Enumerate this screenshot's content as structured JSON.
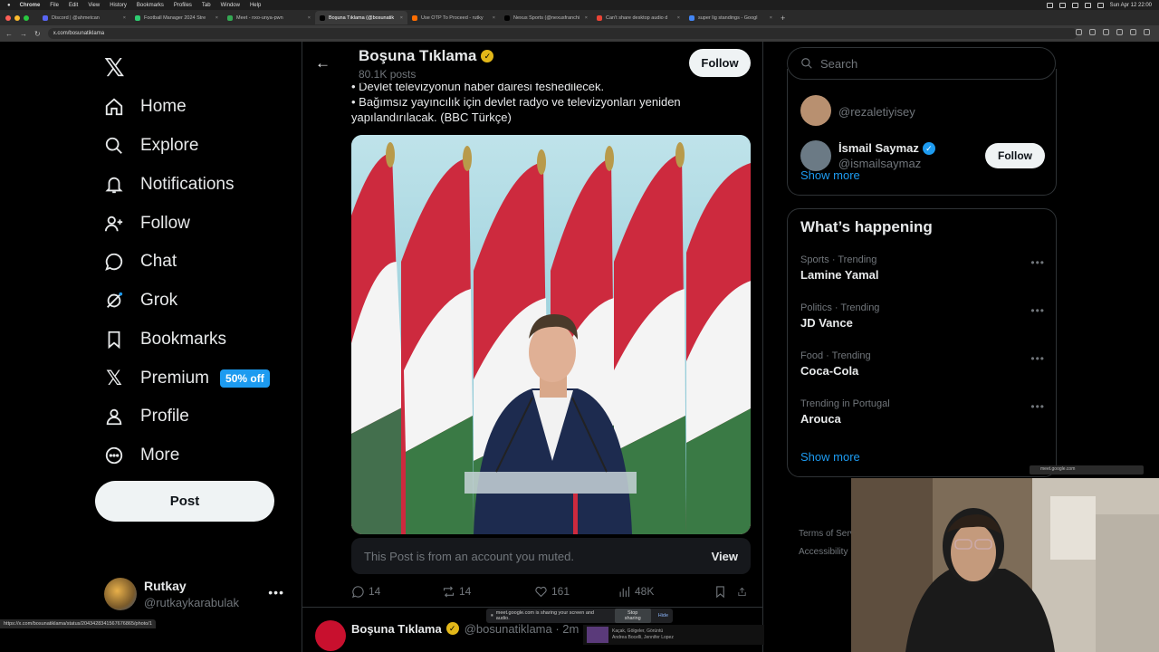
{
  "menubar": {
    "app": "Chrome",
    "items": [
      "File",
      "Edit",
      "View",
      "History",
      "Bookmarks",
      "Profiles",
      "Tab",
      "Window",
      "Help"
    ],
    "datetime": "Sun Apr 12  22:00"
  },
  "browser": {
    "tabs": [
      {
        "label": "Discord | @ahmetcan",
        "color": "#5865f2"
      },
      {
        "label": "Football Manager 2024 Stre",
        "color": "#2ecc71"
      },
      {
        "label": "Meet - nxo-unya-pwn",
        "color": "#34a853"
      },
      {
        "label": "Boşuna Tıklama (@bosunatik",
        "color": "#000000",
        "active": true
      },
      {
        "label": "Use OTP To Proceed - rutky",
        "color": "#ff6d00"
      },
      {
        "label": "Nexus Sports (@nexusfranchi",
        "color": "#000000"
      },
      {
        "label": "Can't share desktop audio d",
        "color": "#ea4335"
      },
      {
        "label": "super lig standings - Googl",
        "color": "#4285f4"
      }
    ],
    "url": "x.com/bosunatiklama"
  },
  "nav": {
    "items": [
      {
        "label": "Home",
        "icon": "home-icon"
      },
      {
        "label": "Explore",
        "icon": "search-icon"
      },
      {
        "label": "Notifications",
        "icon": "bell-icon"
      },
      {
        "label": "Follow",
        "icon": "person-add-icon"
      },
      {
        "label": "Chat",
        "icon": "chat-icon"
      },
      {
        "label": "Grok",
        "icon": "grok-icon"
      },
      {
        "label": "Bookmarks",
        "icon": "bookmark-icon"
      },
      {
        "label": "Premium",
        "icon": "x-icon"
      },
      {
        "label": "Profile",
        "icon": "person-icon"
      },
      {
        "label": "More",
        "icon": "more-circle-icon"
      }
    ],
    "premium_badge": "50% off",
    "post_label": "Post"
  },
  "account": {
    "name": "Rutkay",
    "handle": "@rutkaykarabulak"
  },
  "header": {
    "name": "Boşuna Tıklama",
    "posts": "80.1K posts",
    "follow_label": "Follow"
  },
  "tweet": {
    "lines": [
      "• Devlet televizyonun haber dairesi feshedilecek.",
      "• Bağımsız yayıncılık için devlet radyo ve televizyonları yeniden yapılandırılacak. (BBC Türkçe)"
    ],
    "muted_text": "This Post is from an account you muted.",
    "view_label": "View",
    "replies": "14",
    "reposts": "14",
    "likes": "161",
    "views": "48K"
  },
  "next_tweet": {
    "name": "Boşuna Tıklama",
    "handle": "@bosunatiklama · 2m"
  },
  "search": {
    "placeholder": "Search"
  },
  "who_to_follow": {
    "partial_handle": "@rezaletiyisey",
    "user": {
      "name": "İsmail Saymaz",
      "handle": "@ismailsaymaz"
    },
    "follow_label": "Follow",
    "show_more": "Show more"
  },
  "happening": {
    "title": "What’s happening",
    "trends": [
      {
        "context": "Sports · Trending",
        "name": "Lamine Yamal"
      },
      {
        "context": "Politics · Trending",
        "name": "JD Vance"
      },
      {
        "context": "Food · Trending",
        "name": "Coca-Cola"
      },
      {
        "context": "Trending in Portugal",
        "name": "Arouca"
      }
    ],
    "show_more": "Show more"
  },
  "footer": {
    "terms": "Terms of Serv",
    "accessibility": "Accessibility"
  },
  "overlays": {
    "share_text": "meet.google.com is sharing your screen and audio.",
    "stop_sharing": "Stop sharing",
    "hide": "Hide",
    "status_url": "https://x.com/bosunatiklama/status/2043428341567676865/photo/1",
    "meet_tag": "meet.google.com",
    "media_title": "Kaçak, Gölgeler, Görüntü",
    "media_artist": "Andrea Bocelli, Jennifer Lopez"
  },
  "colors": {
    "accent": "#1d9bf0",
    "verified_gold": "#e2b719",
    "background": "#000000"
  }
}
